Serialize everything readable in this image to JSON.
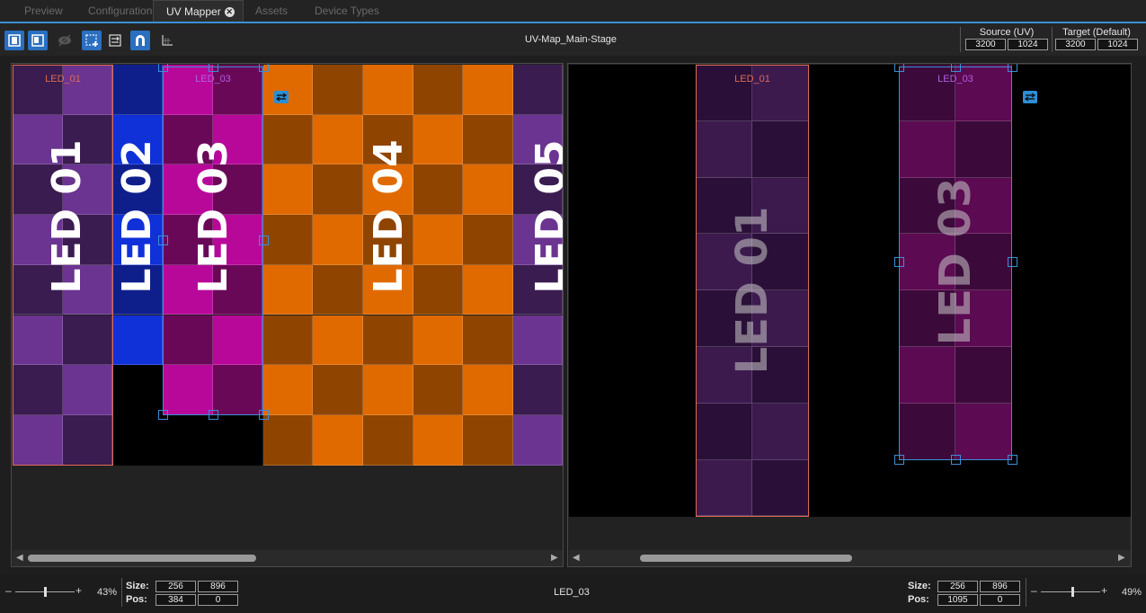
{
  "tabs": [
    {
      "label": "Preview",
      "active": false
    },
    {
      "label": "Configuration",
      "active": false
    },
    {
      "label": "UV Mapper",
      "active": true
    },
    {
      "label": "Assets",
      "active": false
    },
    {
      "label": "Device Types",
      "active": false
    }
  ],
  "tab_close_glyph": "✕",
  "toolbar": {
    "map_title": "UV-Map_Main-Stage",
    "buttons": [
      {
        "icon": "source-view-icon",
        "active": true
      },
      {
        "icon": "target-view-icon",
        "active": true
      },
      {
        "icon": "visibility-icon",
        "active": false
      },
      {
        "icon": "rect-select-icon",
        "active": true
      },
      {
        "icon": "distribute-icon",
        "active": false
      },
      {
        "icon": "magnet-icon",
        "active": true
      },
      {
        "icon": "grid-axis-icon",
        "active": false
      }
    ],
    "source": {
      "label": "Source (UV)",
      "width": "3200",
      "height": "1024"
    },
    "target": {
      "label": "Target (Default)",
      "width": "3200",
      "height": "1024"
    }
  },
  "left_pane": {
    "fixture_names": {
      "led01": "LED_01",
      "led03": "LED_03"
    },
    "big_labels": [
      "LED 01",
      "LED 02",
      "LED 03",
      "LED 04",
      "LED 05"
    ],
    "swap_icon": "swap-icon"
  },
  "right_pane": {
    "fixture_names": {
      "led01": "LED_01",
      "led03": "LED_03"
    },
    "big_labels": [
      "LED 01",
      "LED 03"
    ]
  },
  "footer": {
    "left": {
      "zoom": "43%",
      "size_label": "Size:",
      "pos_label": "Pos:",
      "size_w": "256",
      "size_h": "896",
      "pos_x": "384",
      "pos_y": "0"
    },
    "selected_name": "LED_03",
    "right": {
      "zoom": "49%",
      "size_label": "Size:",
      "pos_label": "Pos:",
      "size_w": "256",
      "size_h": "896",
      "pos_x": "1095",
      "pos_y": "0"
    },
    "minus_glyph": "–",
    "plus_glyph": "+"
  },
  "colors": {
    "accent": "#3b8fd6",
    "purple_dark": "#3a1c50",
    "purple_light": "#6a3490",
    "blue_dark": "#0e1f8c",
    "blue_light": "#1030d8",
    "magenta_dark": "#6a0858",
    "magenta_light": "#b8089a",
    "orange_dark": "#8f4500",
    "orange_light": "#e06a00",
    "led01_name": "#e06a55",
    "led03_name": "#b060e0"
  }
}
